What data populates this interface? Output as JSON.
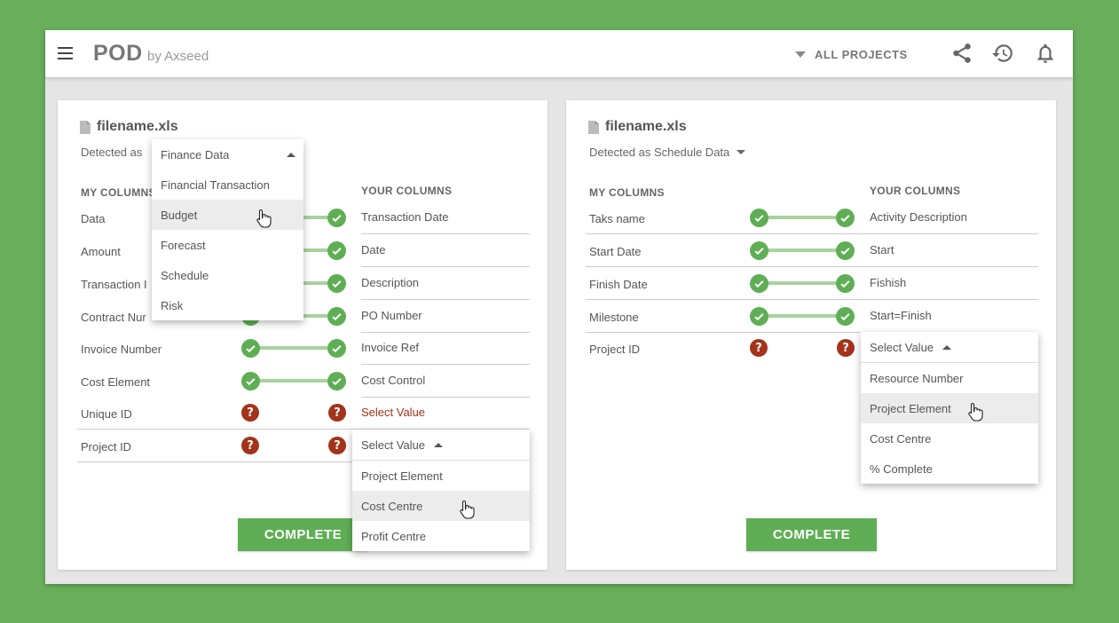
{
  "header": {
    "brand": "POD",
    "brand_sub": "by Axseed",
    "project_filter": "ALL PROJECTS",
    "icons": [
      "menu-icon",
      "share-icon",
      "history-icon",
      "bell-icon"
    ]
  },
  "colors": {
    "background": "#68ae5b",
    "accent": "#5fae55",
    "error": "#a3331a",
    "connector": "#a8d29e"
  },
  "left_panel": {
    "filename": "filename.xls",
    "detected_prefix": "Detected as",
    "my_columns_header": "MY COLUMNS",
    "your_columns_header": "YOUR COLUMNS",
    "rows": [
      {
        "mine": "Data",
        "yours": "Transaction Date"
      },
      {
        "mine": "Amount",
        "yours": "Date"
      },
      {
        "mine": "Transaction I",
        "yours": "Description"
      },
      {
        "mine": "Contract Nur",
        "yours": "PO Number"
      },
      {
        "mine": "Invoice Number",
        "yours": "Invoice Ref"
      },
      {
        "mine": "Cost Element",
        "yours": "Cost Control"
      },
      {
        "mine": "Unique ID",
        "yours": "Select Value"
      },
      {
        "mine": "Project ID",
        "yours": "Select Value"
      }
    ],
    "type_dropdown": {
      "selected": "Finance Data",
      "options": [
        "Financial Transaction",
        "Budget",
        "Forecast",
        "Schedule",
        "Risk"
      ],
      "highlighted": "Budget"
    },
    "value_dropdown": {
      "options": [
        "Project Element",
        "Cost Centre",
        "Profit Centre"
      ],
      "highlighted": "Cost Centre"
    },
    "complete_label": "COMPLETE"
  },
  "right_panel": {
    "filename": "filename.xls",
    "detected_label": "Detected as Schedule Data",
    "my_columns_header": "MY COLUMNS",
    "your_columns_header": "YOUR COLUMNS",
    "rows": [
      {
        "mine": "Taks name",
        "yours": "Activity Description"
      },
      {
        "mine": "Start Date",
        "yours": "Start"
      },
      {
        "mine": "Finish Date",
        "yours": "Fishish"
      },
      {
        "mine": "Milestone",
        "yours": "Start=Finish"
      },
      {
        "mine": "Project ID",
        "yours": "Select Value"
      }
    ],
    "value_dropdown": {
      "options": [
        "Resource Number",
        "Project Element",
        "Cost Centre",
        "% Complete"
      ],
      "highlighted": "Project Element"
    },
    "complete_label": "COMPLETE"
  }
}
